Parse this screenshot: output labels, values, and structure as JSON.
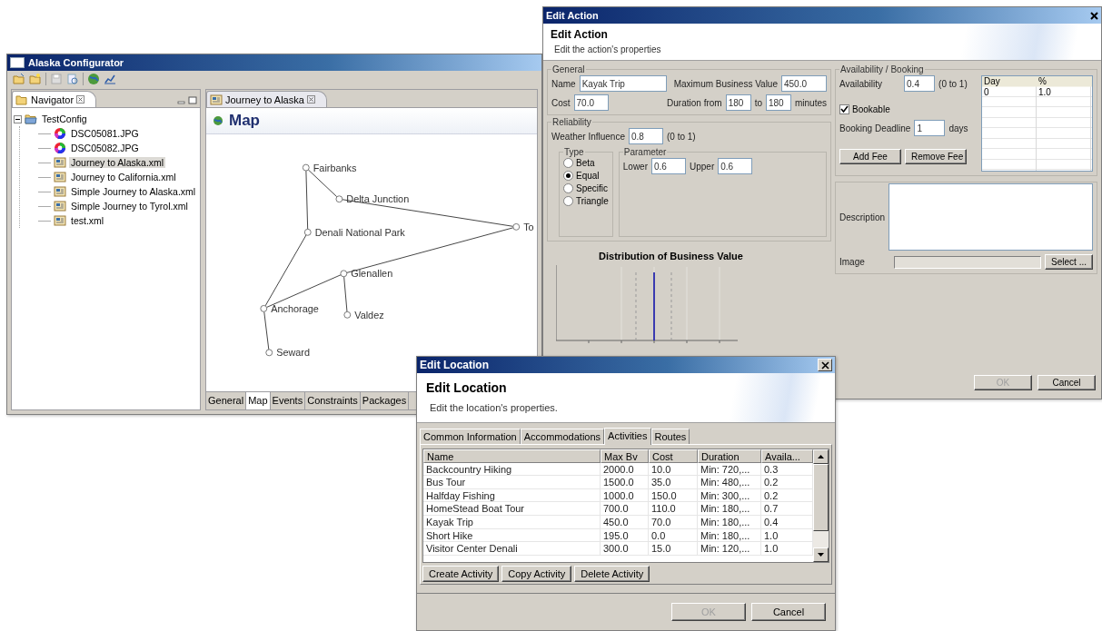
{
  "main_window": {
    "title": "Alaska Configurator",
    "navigator": {
      "title": "Navigator",
      "tree": [
        {
          "label": "TestConfig",
          "kind": "folder",
          "expanded": true,
          "selected": false,
          "children": [
            {
              "label": "DSC05081.JPG",
              "kind": "image",
              "selected": false
            },
            {
              "label": "DSC05082.JPG",
              "kind": "image",
              "selected": false
            },
            {
              "label": "Journey to Alaska.xml",
              "kind": "xml",
              "selected": true
            },
            {
              "label": "Journey to California.xml",
              "kind": "xml",
              "selected": false
            },
            {
              "label": "Simple Journey to Alaska.xml",
              "kind": "xml",
              "selected": false
            },
            {
              "label": "Simple Journey to Tyrol.xml",
              "kind": "xml",
              "selected": false
            },
            {
              "label": "test.xml",
              "kind": "xml",
              "selected": false
            }
          ]
        }
      ]
    },
    "editor": {
      "tab": "Journey to Alaska",
      "heading": "Map",
      "locations": [
        {
          "name": "Fairbanks"
        },
        {
          "name": "Delta Junction"
        },
        {
          "name": "To"
        },
        {
          "name": "Denali National Park"
        },
        {
          "name": "Glenallen"
        },
        {
          "name": "Anchorage"
        },
        {
          "name": "Valdez"
        },
        {
          "name": "Seward"
        }
      ],
      "bottom_tabs": [
        {
          "label": "General",
          "selected": false
        },
        {
          "label": "Map",
          "selected": true
        },
        {
          "label": "Events",
          "selected": false
        },
        {
          "label": "Constraints",
          "selected": false
        },
        {
          "label": "Packages",
          "selected": false
        }
      ]
    }
  },
  "edit_action": {
    "title": "Edit Action",
    "heading": "Edit Action",
    "description": "Edit the action's properties",
    "general": {
      "title": "General",
      "name_label": "Name",
      "name": "Kayak Trip",
      "cost_label": "Cost",
      "cost": "70.0",
      "max_value_label": "Maximum Business Value",
      "max_value": "450.0",
      "duration_label": "Duration from",
      "duration_from": "180",
      "to_label": "to",
      "duration_to": "180",
      "unit": "minutes"
    },
    "reliability": {
      "title": "Reliability",
      "weather_label": "Weather Influence",
      "weather": "0.8",
      "weather_range": "(0 to 1)",
      "type_title": "Type",
      "types": [
        {
          "label": "Beta",
          "selected": false
        },
        {
          "label": "Equal",
          "selected": true
        },
        {
          "label": "Specific",
          "selected": false
        },
        {
          "label": "Triangle",
          "selected": false
        }
      ],
      "parameter_title": "Parameter",
      "lower_label": "Lower",
      "lower": "0.6",
      "upper_label": "Upper",
      "upper": "0.6"
    },
    "chart_title": "Distribution of Business Value",
    "booking": {
      "title": "Availability / Booking",
      "availability_label": "Availability",
      "availability": "0.4",
      "availability_range": "(0 to 1)",
      "bookable_label": "Bookable",
      "bookable": true,
      "deadline_label": "Booking Deadline",
      "deadline": "1",
      "deadline_unit": "days",
      "fee_buttons": [
        "Add Fee",
        "Remove Fee"
      ],
      "fee_columns": [
        "Day",
        "%"
      ],
      "fee_rows": [
        [
          "0",
          "1.0"
        ]
      ]
    },
    "description_label": "Description",
    "image_label": "Image",
    "select_button": "Select ...",
    "buttons": [
      {
        "label": "OK",
        "disabled": true
      },
      {
        "label": "Cancel",
        "disabled": false
      }
    ]
  },
  "edit_location": {
    "title": "Edit Location",
    "heading": "Edit Location",
    "description": "Edit the location's properties.",
    "tabs": [
      {
        "label": "Common Information",
        "selected": false
      },
      {
        "label": "Accommodations",
        "selected": false
      },
      {
        "label": "Activities",
        "selected": true
      },
      {
        "label": "Routes",
        "selected": false
      }
    ],
    "columns": [
      "Name",
      "Max Bv",
      "Cost",
      "Duration",
      "Availa..."
    ],
    "rows": [
      [
        "Backcountry Hiking",
        "2000.0",
        "10.0",
        "Min: 720,...",
        "0.3"
      ],
      [
        "Bus Tour",
        "1500.0",
        "35.0",
        "Min: 480,...",
        "0.2"
      ],
      [
        "Halfday Fishing",
        "1000.0",
        "150.0",
        "Min: 300,...",
        "0.2"
      ],
      [
        "HomeStead Boat Tour",
        "700.0",
        "110.0",
        "Min: 180,...",
        "0.7"
      ],
      [
        "Kayak Trip",
        "450.0",
        "70.0",
        "Min: 180,...",
        "0.4"
      ],
      [
        "Short Hike",
        "195.0",
        "0.0",
        "Min: 180,...",
        "1.0"
      ],
      [
        "Visitor Center Denali",
        "300.0",
        "15.0",
        "Min: 120,...",
        "1.0"
      ]
    ],
    "actions": [
      "Create Activity",
      "Copy Activity",
      "Delete Activity"
    ],
    "buttons": [
      {
        "label": "OK",
        "disabled": true
      },
      {
        "label": "Cancel",
        "disabled": false
      }
    ]
  }
}
